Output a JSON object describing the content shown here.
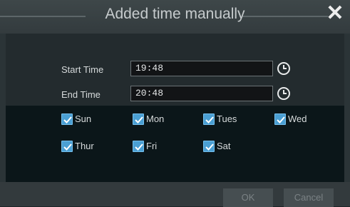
{
  "dialog": {
    "title": "Added time manually",
    "close_glyph": "✕"
  },
  "fields": {
    "start_label": "Start Time",
    "start_value": "19:48",
    "end_label": "End Time",
    "end_value": "20:48"
  },
  "days": [
    {
      "label": "Sun",
      "checked": true
    },
    {
      "label": "Mon",
      "checked": true
    },
    {
      "label": "Tues",
      "checked": true
    },
    {
      "label": "Wed",
      "checked": true
    },
    {
      "label": "Thur",
      "checked": true
    },
    {
      "label": "Fri",
      "checked": true
    },
    {
      "label": "Sat",
      "checked": true
    }
  ],
  "buttons": {
    "ok": "OK",
    "cancel": "Cancel"
  },
  "colors": {
    "accent": "#4a9fd3",
    "title_text": "#c6cbcd"
  }
}
